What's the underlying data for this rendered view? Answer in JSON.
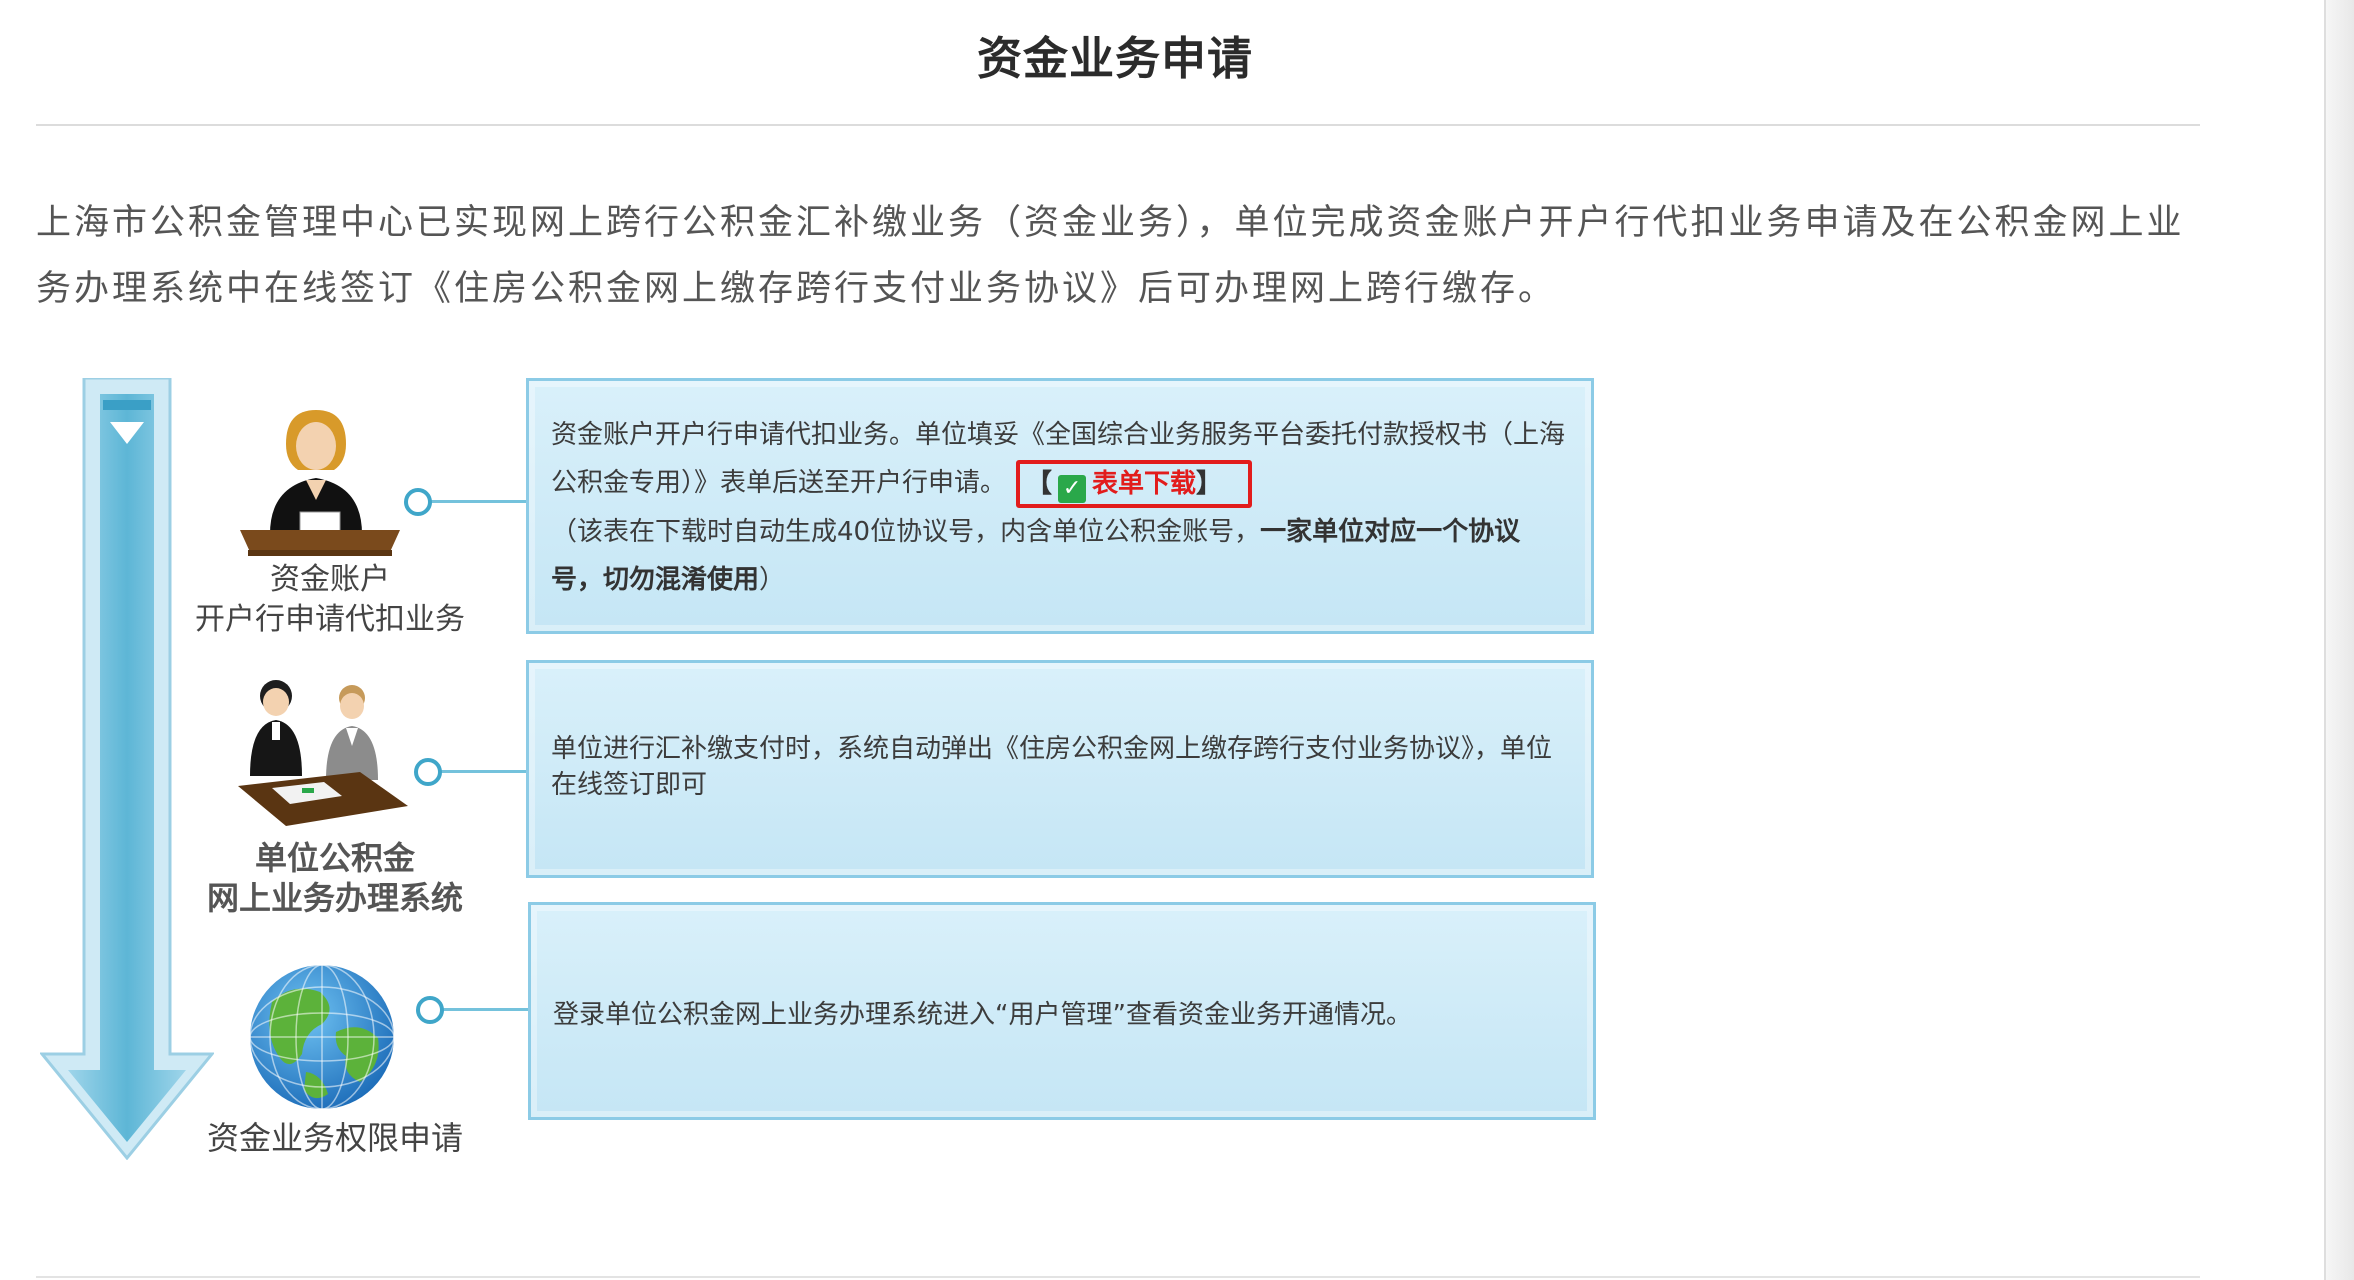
{
  "header": {
    "title": "资金业务申请"
  },
  "intro": {
    "text": "上海市公积金管理中心已实现网上跨行公积金汇补缴业务（资金业务），单位完成资金账户开户行代扣业务申请及在公积金网上业务办理系统中在线签订《住房公积金网上缴存跨行支付业务协议》后可办理网上跨行缴存。"
  },
  "steps": [
    {
      "label_line1": "资金账户",
      "label_line2": "开户行申请代扣业务",
      "text_part1": "资金账户开户行申请代扣业务。单位填妥《全国综合业务服务平台委托付款授权书（上海公积金专用）》表单后送至开户行申请。",
      "download_open": "【",
      "download_label": "表单下载",
      "download_close": "】",
      "note_prefix": "（该表在下载时自动生成40位协议号，内含单位公积金账号，",
      "note_bold": "一家单位对应一个协议号，切勿混淆使用",
      "note_suffix": "）"
    },
    {
      "label_line1": "单位公积金",
      "label_line2": "网上业务办理系统",
      "text": "单位进行汇补缴支付时，系统自动弹出《住房公积金网上缴存跨行支付业务协议》，单位在线签订即可"
    },
    {
      "label_line1": "资金业务权限申请",
      "text": "登录单位公积金网上业务办理系统进入“用户管理”查看资金业务开通情况。"
    }
  ],
  "icons": {
    "download": "download-icon",
    "flow": "down-arrow-icon",
    "step1": "person-at-desk-icon",
    "step2": "business-meeting-icon",
    "step3": "globe-icon"
  },
  "colors": {
    "box_fill": "#d2ecf8",
    "box_border": "#8ccbe6",
    "arrow": "#4aa9cc",
    "download_highlight": "#e21c1c",
    "download_icon": "#2aa84a"
  }
}
